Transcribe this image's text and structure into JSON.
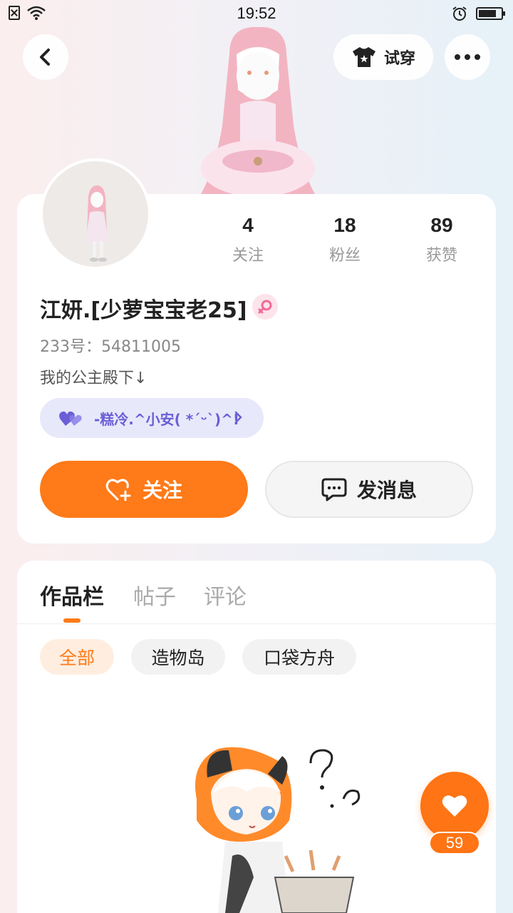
{
  "status_bar": {
    "time": "19:52"
  },
  "header": {
    "tryon_label": "试穿"
  },
  "profile": {
    "stats": [
      {
        "value": "4",
        "label": "关注"
      },
      {
        "value": "18",
        "label": "粉丝"
      },
      {
        "value": "89",
        "label": "获赞"
      }
    ],
    "nickname": "江妍.[少萝宝宝老25]",
    "user_id": "233号：54811005",
    "bio": "我的公主殿下↓",
    "relation_pill": "-糕冷.^小安( *´ᵕ`)^!",
    "follow_label": "关注",
    "message_label": "发消息"
  },
  "works": {
    "tabs": [
      "作品栏",
      "帖子",
      "评论"
    ],
    "filters": [
      "全部",
      "造物岛",
      "口袋方舟"
    ]
  },
  "like_fab": {
    "count": "59"
  },
  "colors": {
    "accent": "#ff7a18",
    "pill_text": "#6a5fd6",
    "pill_bg": "#e8e8fb"
  }
}
